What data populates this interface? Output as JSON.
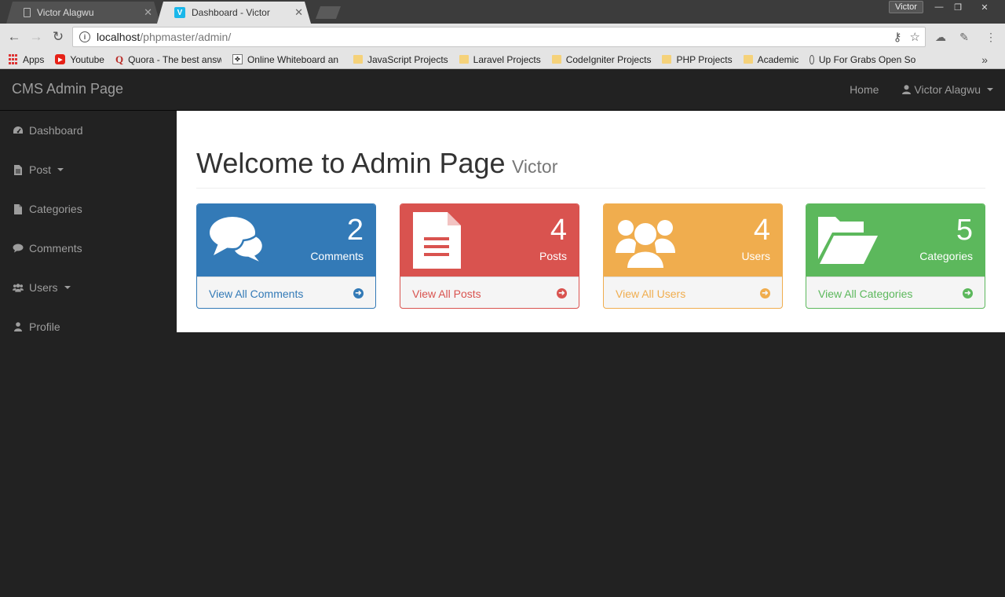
{
  "browser": {
    "tabs": [
      {
        "title": "Victor Alagwu",
        "icon": "document-icon",
        "active": false
      },
      {
        "title": "Dashboard - Victor",
        "icon": "vimeo-icon",
        "active": true
      }
    ],
    "profile_name": "Victor",
    "url_host": "localhost",
    "url_path": "/phpmaster/admin/",
    "bookmarks": [
      {
        "label": "Apps",
        "icon": "apps-grid-icon"
      },
      {
        "label": "Youtube",
        "icon": "youtube-icon"
      },
      {
        "label": "Quora - The best answ",
        "icon": "quora-icon"
      },
      {
        "label": "Online Whiteboard an",
        "icon": "whiteboard-icon"
      },
      {
        "label": "JavaScript Projects",
        "icon": "folder-icon"
      },
      {
        "label": "Laravel Projects",
        "icon": "folder-icon"
      },
      {
        "label": "CodeIgniter Projects",
        "icon": "folder-icon"
      },
      {
        "label": "PHP Projects",
        "icon": "folder-icon"
      },
      {
        "label": "Academic",
        "icon": "folder-icon"
      },
      {
        "label": "Up For Grabs Open So",
        "icon": "circle-icon"
      }
    ]
  },
  "navbar": {
    "brand": "CMS Admin Page",
    "home": "Home",
    "user": "Victor Alagwu"
  },
  "sidebar": {
    "items": [
      {
        "label": "Dashboard",
        "icon": "dashboard-icon",
        "dropdown": false
      },
      {
        "label": "Post",
        "icon": "file-icon",
        "dropdown": true
      },
      {
        "label": "Categories",
        "icon": "file-icon",
        "dropdown": false
      },
      {
        "label": "Comments",
        "icon": "comment-icon",
        "dropdown": false
      },
      {
        "label": "Users",
        "icon": "users-icon",
        "dropdown": true
      },
      {
        "label": "Profile",
        "icon": "user-icon",
        "dropdown": false
      }
    ]
  },
  "main": {
    "title": "Welcome to Admin Page",
    "subtitle": "Victor",
    "panels": [
      {
        "count": "2",
        "label": "Comments",
        "link": "View All Comments",
        "icon": "comments-icon",
        "color": "#337ab7"
      },
      {
        "count": "4",
        "label": "Posts",
        "link": "View All Posts",
        "icon": "file-text-icon",
        "color": "#d9534f"
      },
      {
        "count": "4",
        "label": "Users",
        "link": "View All Users",
        "icon": "users-icon",
        "color": "#f0ad4e"
      },
      {
        "count": "5",
        "label": "Categories",
        "link": "View All Categories",
        "icon": "folder-open-icon",
        "color": "#5cb85c"
      }
    ]
  }
}
